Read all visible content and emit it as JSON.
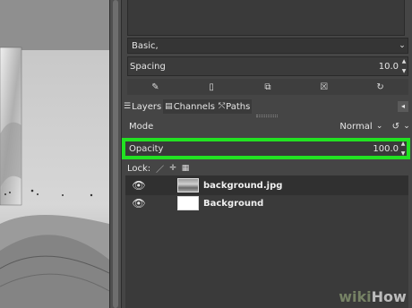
{
  "brush": {
    "preset_value": "Basic,",
    "spacing_label": "Spacing",
    "spacing_value": "10.0",
    "tools": [
      {
        "icon": "edit-brush-icon",
        "glyph": "✎"
      },
      {
        "icon": "new-brush-icon",
        "glyph": "▯"
      },
      {
        "icon": "duplicate-brush-icon",
        "glyph": "⧉"
      },
      {
        "icon": "delete-brush-icon",
        "glyph": "☒"
      },
      {
        "icon": "refresh-brushes-icon",
        "glyph": "↻"
      }
    ]
  },
  "dock_tabs": {
    "layers": "Layers",
    "channels": "Channels",
    "paths": "Paths",
    "active_tab": "Layers"
  },
  "layers_panel": {
    "mode_label": "Mode",
    "mode_value": "Normal",
    "opacity_label": "Opacity",
    "opacity_value": "100.0",
    "lock_label": "Lock:",
    "highlight_color": "#22e222",
    "layers": [
      {
        "name": "background.jpg",
        "visible": true,
        "thumbnail": "photo",
        "selected": true
      },
      {
        "name": "Background",
        "visible": true,
        "thumbnail": "white",
        "selected": false
      }
    ]
  },
  "watermark": {
    "part1": "wiki",
    "part2": "How"
  }
}
